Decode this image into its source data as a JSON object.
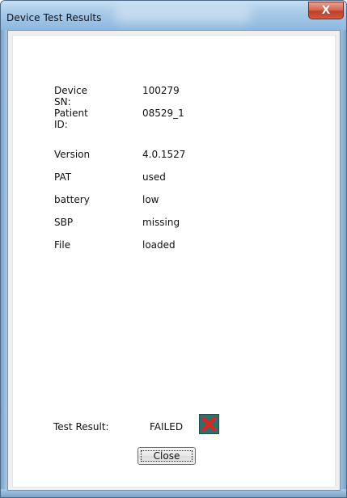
{
  "window": {
    "title": "Device Test Results",
    "close_symbol": "X"
  },
  "fields": {
    "device_sn": {
      "label": "Device SN:",
      "value": "100279"
    },
    "patient_id": {
      "label": "Patient ID:",
      "value": "08529_1"
    },
    "version": {
      "label": "Version",
      "value": "4.0.1527"
    },
    "pat": {
      "label": "PAT",
      "value": "used"
    },
    "battery": {
      "label": "battery",
      "value": "low"
    },
    "sbp": {
      "label": "SBP",
      "value": "missing"
    },
    "file": {
      "label": "File",
      "value": "loaded"
    }
  },
  "result": {
    "label": "Test Result:",
    "value": "FAILED",
    "icon": "red-x-icon",
    "colors": {
      "icon_bg": "#2f6f6a",
      "x_color": "#e32222"
    }
  },
  "buttons": {
    "close_label": "Close"
  }
}
